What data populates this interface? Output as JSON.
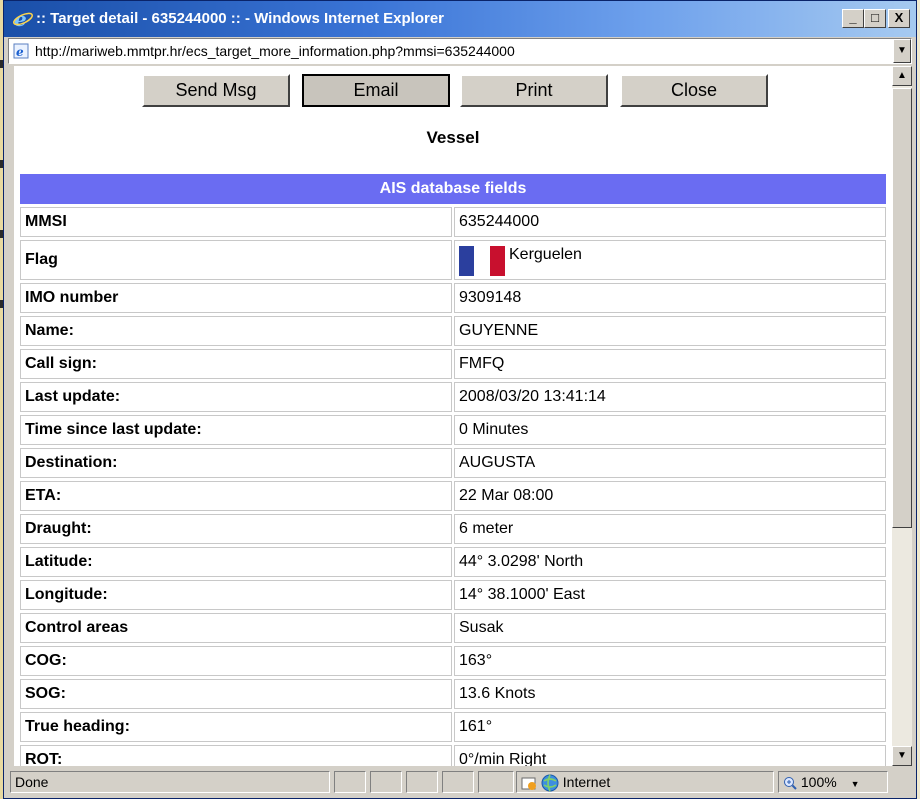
{
  "window": {
    "title": ":: Target detail - 635244000 :: - Windows Internet Explorer",
    "minimize_glyph": "_",
    "maximize_glyph": "□",
    "close_glyph": "X"
  },
  "address": {
    "url": "http://mariweb.mmtpr.hr/ecs_target_more_information.php?mmsi=635244000"
  },
  "toolbar": {
    "send_msg": "Send Msg",
    "email": "Email",
    "print": "Print",
    "close": "Close"
  },
  "heading": "Vessel",
  "table": {
    "header": "AIS database fields",
    "rows": [
      {
        "label": "MMSI",
        "value": "635244000"
      },
      {
        "label": "Flag",
        "value": "Kerguelen"
      },
      {
        "label": "IMO number",
        "value": "9309148"
      },
      {
        "label": "Name:",
        "value": "GUYENNE"
      },
      {
        "label": "Call sign:",
        "value": "FMFQ"
      },
      {
        "label": "Last update:",
        "value": "2008/03/20 13:41:14"
      },
      {
        "label": "Time since last update:",
        "value": "0 Minutes"
      },
      {
        "label": "Destination:",
        "value": "AUGUSTA"
      },
      {
        "label": "ETA:",
        "value": "22 Mar 08:00"
      },
      {
        "label": "Draught:",
        "value": "6 meter"
      },
      {
        "label": "Latitude:",
        "value": "44° 3.0298' North"
      },
      {
        "label": "Longitude:",
        "value": "14° 38.1000' East"
      },
      {
        "label": "Control areas",
        "value": "Susak"
      },
      {
        "label": "COG:",
        "value": "163°"
      },
      {
        "label": "SOG:",
        "value": "13.6 Knots"
      },
      {
        "label": "True heading:",
        "value": "161°"
      },
      {
        "label": "ROT:",
        "value": "0°/min Right"
      }
    ]
  },
  "flag_colors": [
    "#2b3f9e",
    "#ffffff",
    "#c8102e"
  ],
  "status": {
    "text": "Done",
    "zone": "Internet",
    "zoom": "100%"
  },
  "colors": {
    "table_header_bg": "#6a6cf2",
    "titlebar_start": "#1a4fa8"
  }
}
